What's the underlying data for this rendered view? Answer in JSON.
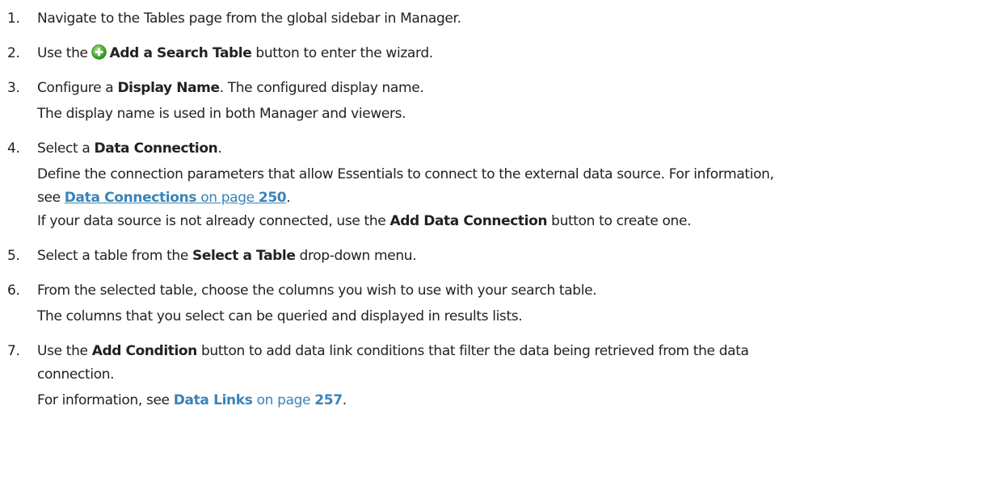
{
  "steps": [
    {
      "num": "1.",
      "text": "Navigate to the Tables page from the global sidebar in Manager."
    },
    {
      "num": "2.",
      "pre": "Use the",
      "bold": "Add a Search Table",
      "post": "button to enter the wizard.",
      "icon": "add-circle-icon"
    },
    {
      "num": "3.",
      "pre": "Configure a",
      "bold": "Display Name",
      "post": ". The configured display name.",
      "line2": "The display name is used in both Manager and viewers."
    },
    {
      "num": "4.",
      "pre": "Select a",
      "bold": "Data Connection",
      "post": ".",
      "line2": "Define the connection parameters that allow Essentials to connect to the external data source. For information,",
      "line3_pre": "see",
      "link": "Data Connections",
      "on_page": "on page",
      "page": "250",
      "line3_post": ".",
      "line4_pre": "If your data source is not already connected, use the",
      "line4_bold": "Add Data Connection",
      "line4_post": "button to create one."
    },
    {
      "num": "5.",
      "pre": "Select a table from the",
      "bold": "Select a Table",
      "post": "drop-down menu."
    },
    {
      "num": "6.",
      "text": "From the selected table, choose the columns you wish to use with your search table.",
      "line2": "The columns that you select can be queried and displayed in results lists."
    },
    {
      "num": "7.",
      "pre": "Use the",
      "bold": "Add Condition",
      "post": "button to add data link conditions that filter the data being retrieved from the data",
      "line1b": "connection.",
      "line2_pre": "For information, see",
      "link": "Data Links",
      "on_page": "on page",
      "page": "257",
      "line2_post": "."
    }
  ],
  "colors": {
    "text": "#222222",
    "link": "#3a83b8",
    "icon_green": "#4caf50"
  }
}
